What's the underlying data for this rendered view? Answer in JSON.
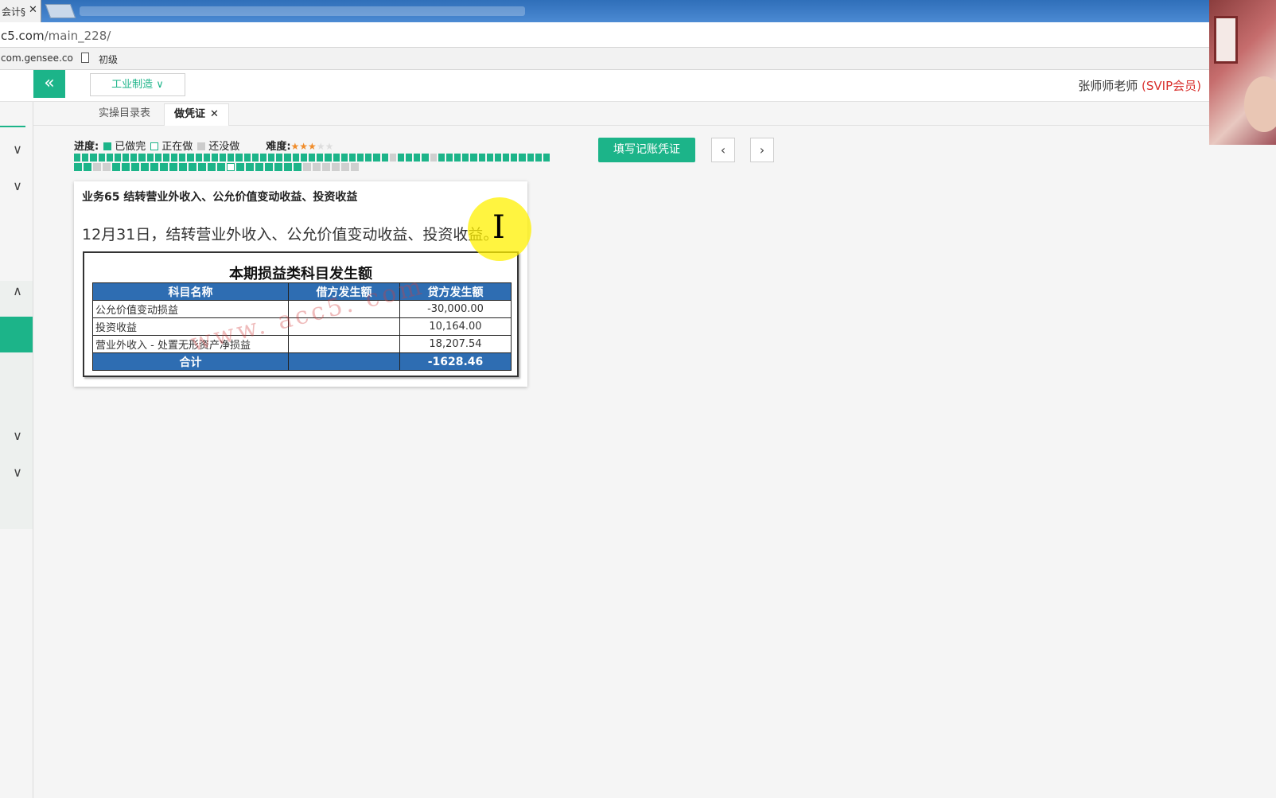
{
  "browser": {
    "tab_label": "会计§",
    "tab_close": "✕",
    "url_host": "c5.com",
    "url_path": "/main_228/",
    "bookmark_1": "com.gensee.co",
    "bookmark_2": "初级"
  },
  "header": {
    "collapse_icon": "«",
    "industry": "工业制造 ∨",
    "user_name": "张师师老师",
    "user_level": "(SVIP会员)"
  },
  "tabs": [
    {
      "label": "实操目录表"
    },
    {
      "label": "做凭证",
      "close": "✕"
    }
  ],
  "sidebar": {
    "chevrons": [
      "∨",
      "∨",
      "∧",
      "∨",
      "∨"
    ]
  },
  "progress": {
    "label": "进度:",
    "done_label": "已做完",
    "doing_label": "正在做",
    "todo_label": "还没做",
    "difficulty_label": "难度:",
    "difficulty_stars": 3,
    "difficulty_max": 5,
    "row1": "DDDDDDDDDDDDDDDDDDDDDDDDDDDDDDDDDDDDDDDTDDDDTDDDDDDDDDDDDDD",
    "row2": "DDTTDDDDDDDDDDDDCDDDDDDD",
    "row2_todo_tail": 6
  },
  "toolbar": {
    "fill_label": "填写记账凭证",
    "prev_icon": "‹",
    "next_icon": "›"
  },
  "task": {
    "title": "业务65 结转营业外收入、公允价值变动收益、投资收益",
    "description": "12月31日，结转营业外收入、公允价值变动收益、投资收益。",
    "cursor": "I"
  },
  "sheet": {
    "title": "本期损益类科目发生额",
    "watermark": "www. acc5. com",
    "headers": [
      "科目名称",
      "借方发生额",
      "贷方发生额"
    ],
    "rows": [
      [
        "公允价值变动损益",
        "",
        "-30,000.00"
      ],
      [
        "投资收益",
        "",
        "10,164.00"
      ],
      [
        "营业外收入 - 处置无形资产净损益",
        "",
        "18,207.54"
      ]
    ],
    "total": [
      "合计",
      "",
      "-1628.46"
    ]
  },
  "colors": {
    "accent": "#1cb489",
    "table_header": "#2e6db2",
    "vip": "#d9322f"
  }
}
